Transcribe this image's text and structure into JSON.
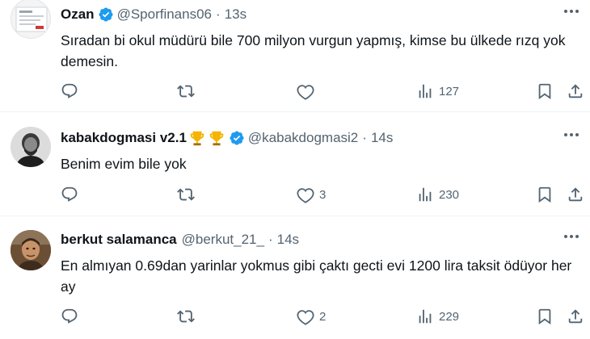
{
  "tweets": [
    {
      "name": "Ozan",
      "verified": true,
      "emoji": "",
      "handle": "@Sporfinans06",
      "time": "13s",
      "text": "Sıradan bi okul müdürü bile 700 milyon vurgun yapmış, kimse bu ülkede rızq yok demesin.",
      "likes": "",
      "views": "127"
    },
    {
      "name": "kabakdogmasi v2.1",
      "verified": true,
      "emoji": "trophy-icons",
      "handle": "@kabakdogmasi2",
      "time": "14s",
      "text": "Benim evim bile yok",
      "likes": "3",
      "views": "230"
    },
    {
      "name": "berkut salamanca",
      "verified": false,
      "emoji": "",
      "handle": "@berkut_21_",
      "time": "14s",
      "text": "En almıyan 0.69dan yarinlar yokmus gibi çaktı gecti evi 1200 lira taksit ödüyor her ay",
      "likes": "2",
      "views": "229"
    }
  ],
  "dot": "·",
  "colors": {
    "verified": "#1d9bf0",
    "secondary": "#536471",
    "text": "#0f1419"
  }
}
